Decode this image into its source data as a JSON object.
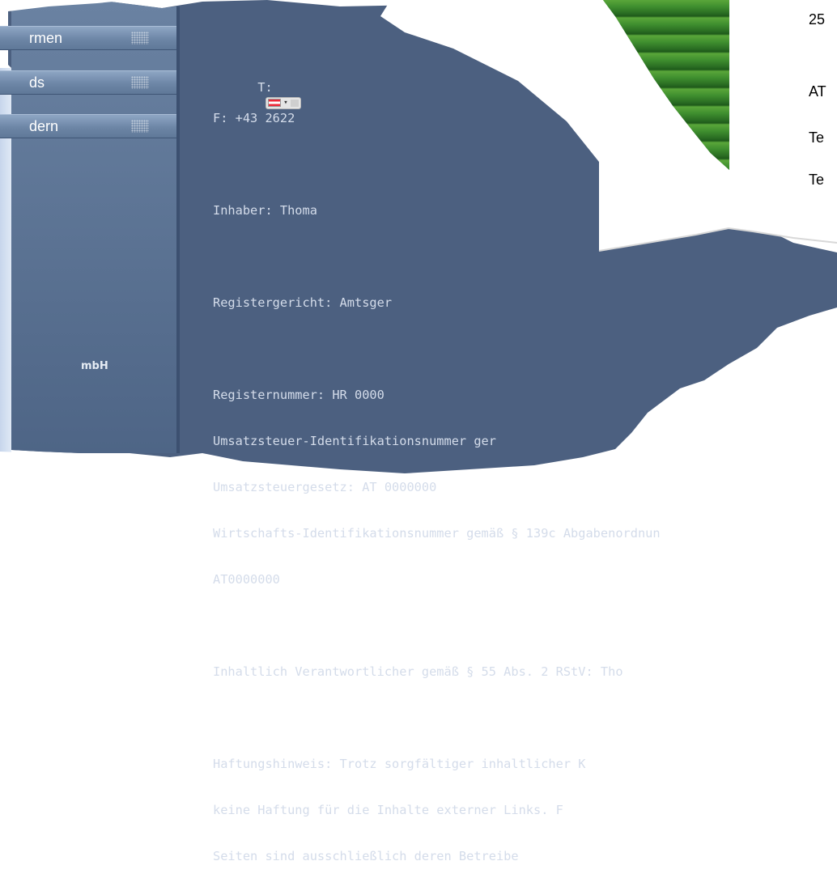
{
  "sidebar": {
    "items": [
      {
        "label": "rmen"
      },
      {
        "label": "ds"
      },
      {
        "label": "dern"
      }
    ],
    "footer": "mbH"
  },
  "contact": {
    "phone_prefix": "T:",
    "fax_line": "F: +43 2622"
  },
  "content": {
    "owner": "Inhaber: Thoma",
    "court": "Registergericht: Amtsger",
    "register_number": "Registernummer: HR 0000",
    "vat_line1": "Umsatzsteuer-Identifikationsnummer ger",
    "vat_line2": "Umsatzsteuergesetz: AT 0000000",
    "wid_line1": "Wirtschafts-Identifikationsnummer gemäß § 139c Abgabenordnun",
    "wid_line2": "AT0000000",
    "responsible": "Inhaltlich Verantwortlicher gemäß § 55 Abs. 2 RStV: Tho",
    "liability_line1": "Haftungshinweis: Trotz sorgfältiger inhaltlicher K",
    "liability_line2": "keine Haftung für die Inhalte externer Links. F",
    "liability_line3": "Seiten sind ausschließlich deren Betreibe"
  },
  "card": {
    "line1": "25",
    "line2": "AT",
    "line3": "Te",
    "line4": "Te"
  },
  "colors": {
    "page_bg": "#4c6080",
    "sidebar_bg": "#5a7292",
    "text": "#d4dcea",
    "accent_green": "#2f7d2a"
  }
}
